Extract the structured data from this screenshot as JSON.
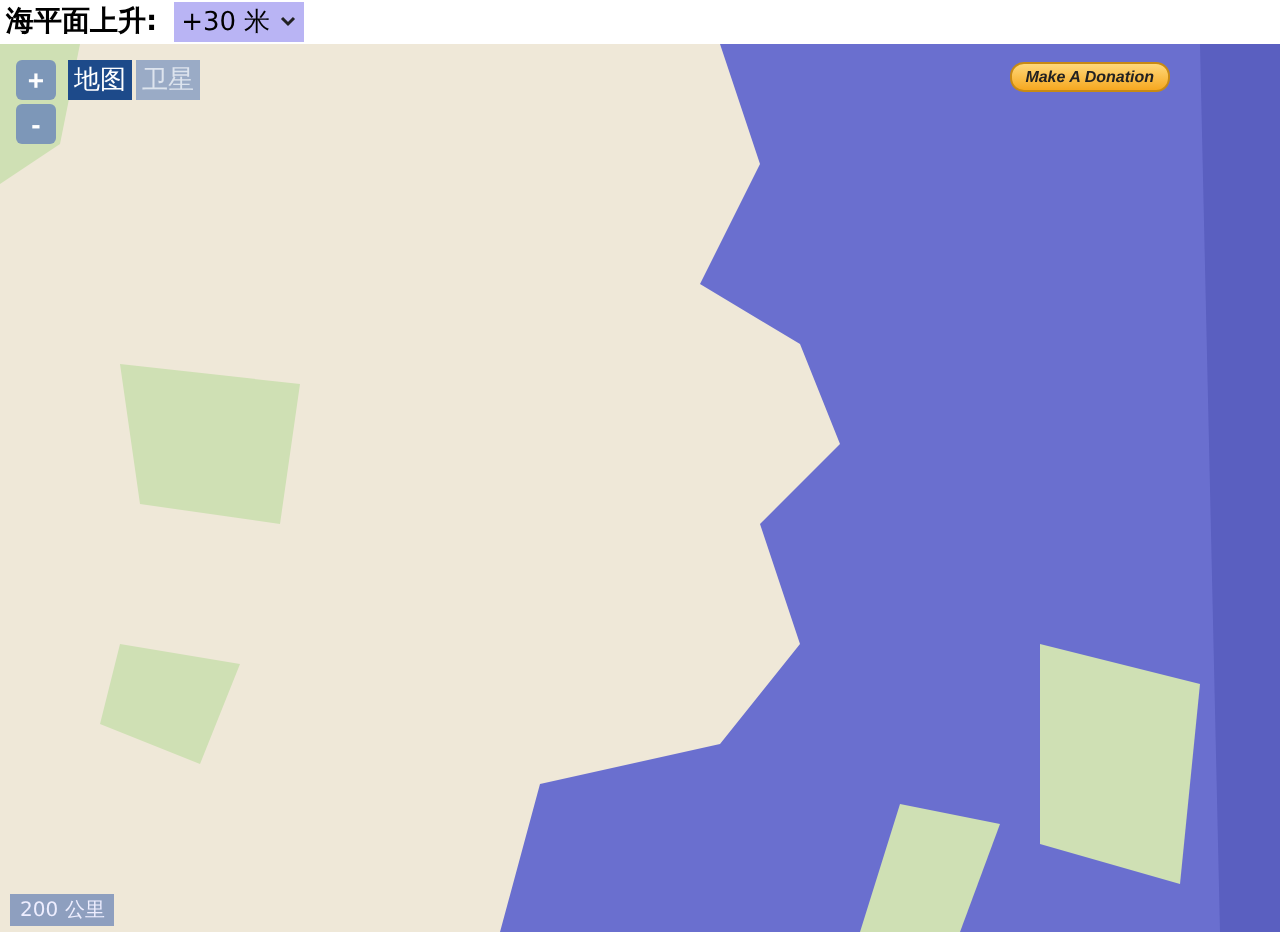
{
  "header": {
    "label": "海平面上升:",
    "select": {
      "value": "+30 米"
    }
  },
  "map": {
    "zoom_buttons": [
      "+",
      "-"
    ],
    "map_types": [
      {
        "label": "地图",
        "selected": true
      },
      {
        "label": "卫星",
        "selected": false
      }
    ],
    "donation_button": "Make A Donation",
    "scale": "200 公里"
  }
}
